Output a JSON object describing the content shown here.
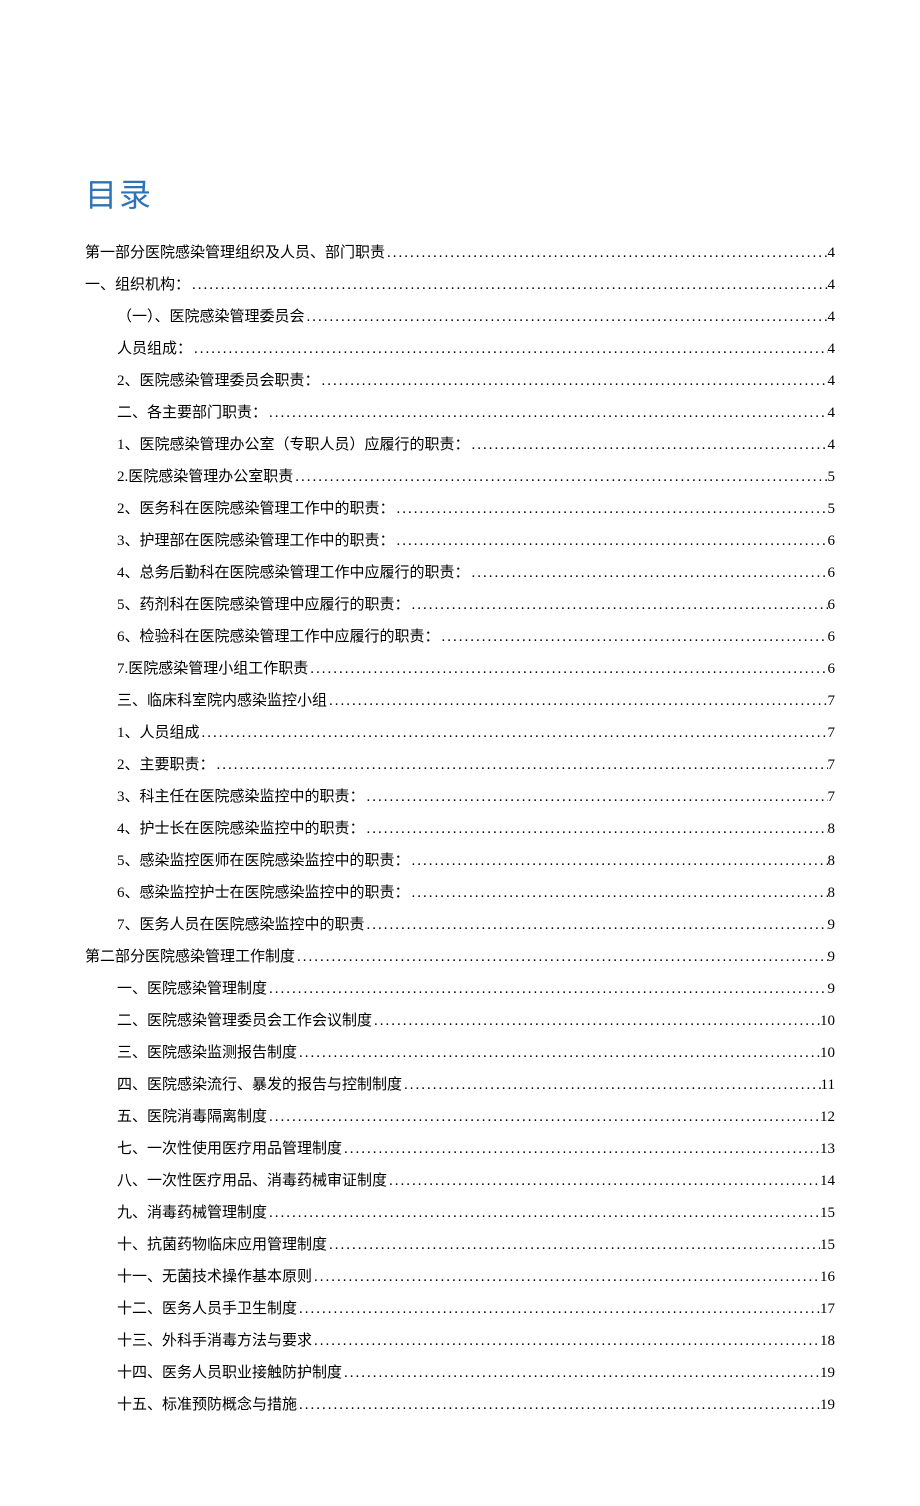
{
  "title": "目录",
  "toc": [
    {
      "indent": 0,
      "label": "第一部分医院感染管理组织及人员、部门职责 ",
      "page": "4"
    },
    {
      "indent": 0,
      "label": "一、组织机构：",
      "page": "4"
    },
    {
      "indent": 1,
      "label": "（一）、医院感染管理委员会 ",
      "page": "4"
    },
    {
      "indent": 1,
      "label": "人员组成：",
      "page": "4"
    },
    {
      "indent": 1,
      "label": "2、医院感染管理委员会职责：",
      "page": "4"
    },
    {
      "indent": 1,
      "label": "二、各主要部门职责：",
      "page": "4"
    },
    {
      "indent": 1,
      "label": "1、医院感染管理办公室（专职人员）应履行的职责：",
      "page": "4"
    },
    {
      "indent": 1,
      "label": "2.医院感染管理办公室职责 ",
      "page": "5"
    },
    {
      "indent": 1,
      "label": "2、医务科在医院感染管理工作中的职责：",
      "page": "5"
    },
    {
      "indent": 1,
      "label": "3、护理部在医院感染管理工作中的职责：",
      "page": "6"
    },
    {
      "indent": 1,
      "label": "4、总务后勤科在医院感染管理工作中应履行的职责：",
      "page": "6"
    },
    {
      "indent": 1,
      "label": "5、药剂科在医院感染管理中应履行的职责：",
      "page": "6"
    },
    {
      "indent": 1,
      "label": "6、检验科在医院感染管理工作中应履行的职责：",
      "page": "6"
    },
    {
      "indent": 1,
      "label": "7.医院感染管理小组工作职责 ",
      "page": "6"
    },
    {
      "indent": 1,
      "label": "三、临床科室院内感染监控小组 ",
      "page": "7"
    },
    {
      "indent": 1,
      "label": "1、人员组成 ",
      "page": "7"
    },
    {
      "indent": 1,
      "label": "2、主要职责：",
      "page": "7"
    },
    {
      "indent": 1,
      "label": "3、科主任在医院感染监控中的职责：",
      "page": "7"
    },
    {
      "indent": 1,
      "label": "4、护士长在医院感染监控中的职责：",
      "page": "8"
    },
    {
      "indent": 1,
      "label": "5、感染监控医师在医院感染监控中的职责：",
      "page": "8"
    },
    {
      "indent": 1,
      "label": "6、感染监控护士在医院感染监控中的职责：",
      "page": "8"
    },
    {
      "indent": 1,
      "label": "7、医务人员在医院感染监控中的职责 ",
      "page": "9"
    },
    {
      "indent": 0,
      "label": "第二部分医院感染管理工作制度 ",
      "page": "9"
    },
    {
      "indent": 1,
      "label": "一、医院感染管理制度 ",
      "page": "9"
    },
    {
      "indent": 1,
      "label": "二、医院感染管理委员会工作会议制度 ",
      "page": "10"
    },
    {
      "indent": 1,
      "label": "三、医院感染监测报告制度 ",
      "page": "10"
    },
    {
      "indent": 1,
      "label": "四、医院感染流行、暴发的报告与控制制度 ",
      "page": "11"
    },
    {
      "indent": 1,
      "label": "五、医院消毒隔离制度 ",
      "page": "12"
    },
    {
      "indent": 1,
      "label": "七、一次性使用医疗用品管理制度 ",
      "page": "13"
    },
    {
      "indent": 1,
      "label": "八、一次性医疗用品、消毒药械审证制度 ",
      "page": "14"
    },
    {
      "indent": 1,
      "label": "九、消毒药械管理制度 ",
      "page": "15"
    },
    {
      "indent": 1,
      "label": "十、抗菌药物临床应用管理制度 ",
      "page": "15"
    },
    {
      "indent": 1,
      "label": "十一、无菌技术操作基本原则 ",
      "page": "16"
    },
    {
      "indent": 1,
      "label": "十二、医务人员手卫生制度 ",
      "page": "17"
    },
    {
      "indent": 1,
      "label": "十三、外科手消毒方法与要求 ",
      "page": "18"
    },
    {
      "indent": 1,
      "label": "十四、医务人员职业接触防护制度 ",
      "page": "19"
    },
    {
      "indent": 1,
      "label": "十五、标准预防概念与措施 ",
      "page": "19"
    }
  ]
}
